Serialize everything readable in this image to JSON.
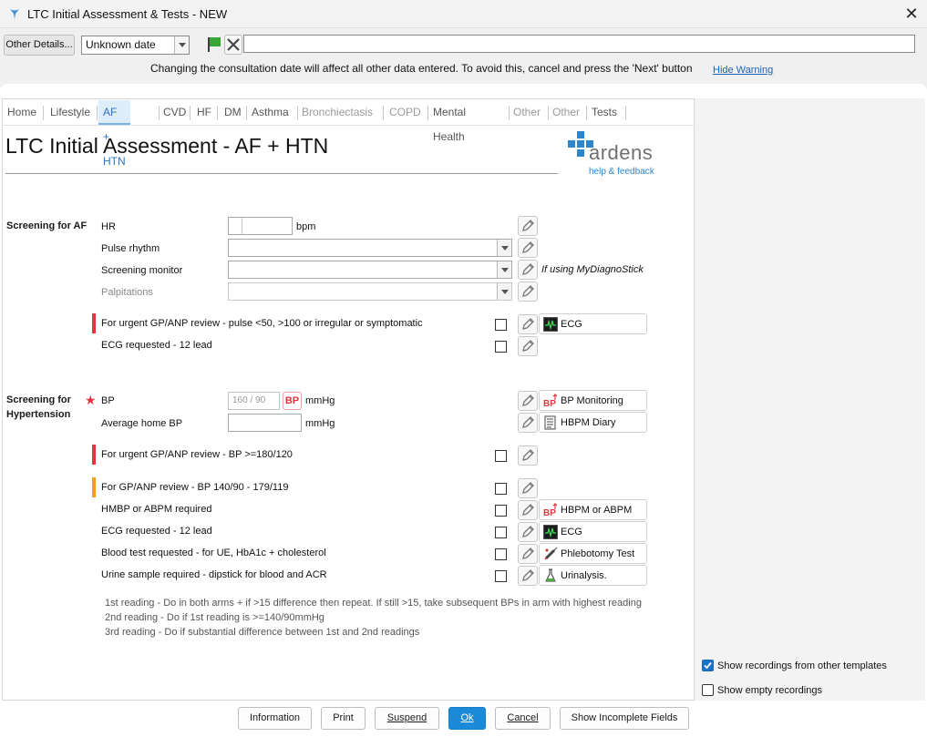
{
  "window": {
    "title": "LTC Initial Assessment & Tests - NEW",
    "close": "✕"
  },
  "toolbar": {
    "other_details": "Other Details...",
    "date_value": "Unknown date",
    "warning": "Changing the consultation date will affect all other data entered. To avoid this, cancel and press the 'Next' button",
    "hide_warning": "Hide Warning"
  },
  "tabs": [
    {
      "label": "Home"
    },
    {
      "label": "Lifestyle"
    },
    {
      "label": "AF + HTN"
    },
    {
      "label": "CVD"
    },
    {
      "label": "HF"
    },
    {
      "label": "DM"
    },
    {
      "label": "Asthma"
    },
    {
      "label": "Bronchiectasis"
    },
    {
      "label": "COPD"
    },
    {
      "label": "Mental Health"
    },
    {
      "label": "Other"
    },
    {
      "label": "Other"
    },
    {
      "label": "Tests"
    }
  ],
  "page": {
    "title": "LTC Initial Assessment - AF + HTN",
    "logo_text": "ardens",
    "logo_help": "help & feedback"
  },
  "af": {
    "section_title": "Screening for AF",
    "hr_label": "HR",
    "hr_unit": "bpm",
    "pulse_rhythm": "Pulse rhythm",
    "screening_monitor": "Screening monitor",
    "screening_hint": "If using MyDiagnoStick",
    "palpitations": "Palpitations",
    "urgent_label": "For urgent GP/ANP review - pulse <50, >100 or irregular or symptomatic",
    "ecg_button": "ECG",
    "ecg_requested": "ECG requested - 12 lead"
  },
  "htn": {
    "section_title_1": "Screening for",
    "section_title_2": "Hypertension",
    "required_star": "★",
    "bp_label": "BP",
    "bp_placeholder": "160 / 90",
    "bp_icon": "BP",
    "bp_unit": "mmHg",
    "bp_monitoring": "BP Monitoring",
    "avg_home_bp": "Average home BP",
    "avg_unit": "mmHg",
    "hbpm_diary": "HBPM Diary",
    "urgent_label": "For urgent GP/ANP review - BP >=180/120",
    "review_label": "For GP/ANP review - BP 140/90 - 179/119",
    "hmbp_label": "HMBP or ABPM required",
    "hbpm_abpm_btn": "HBPM or ABPM",
    "ecg_label": "ECG requested - 12 lead",
    "ecg_btn": "ECG",
    "blood_label": "Blood test requested - for UE, HbA1c + cholesterol",
    "phlebotomy_btn": "Phlebotomy Test",
    "urine_label": "Urine sample required - dipstick for blood and ACR",
    "urinalysis_btn": "Urinalysis.",
    "notes": [
      "1st reading - Do in both arms + if >15 difference then repeat. If still >15, take subsequent BPs in arm with highest reading",
      "2nd reading - Do if 1st reading is >=140/90mmHg",
      "3rd reading - Do if substantial difference between 1st and 2nd readings"
    ]
  },
  "right_panel": {
    "show_other_templates": "Show recordings from other templates",
    "show_other_templates_checked": true,
    "show_empty": "Show empty recordings",
    "show_empty_checked": false
  },
  "footer": {
    "information": "Information",
    "print": "Print",
    "suspend": "Suspend",
    "ok": "Ok",
    "cancel": "Cancel",
    "show_incomplete": "Show Incomplete Fields"
  },
  "colors": {
    "accent": "#1a8ad9",
    "urgent": "#e3343f",
    "review": "#f0a11b",
    "tab_active": "#2a72c2"
  }
}
